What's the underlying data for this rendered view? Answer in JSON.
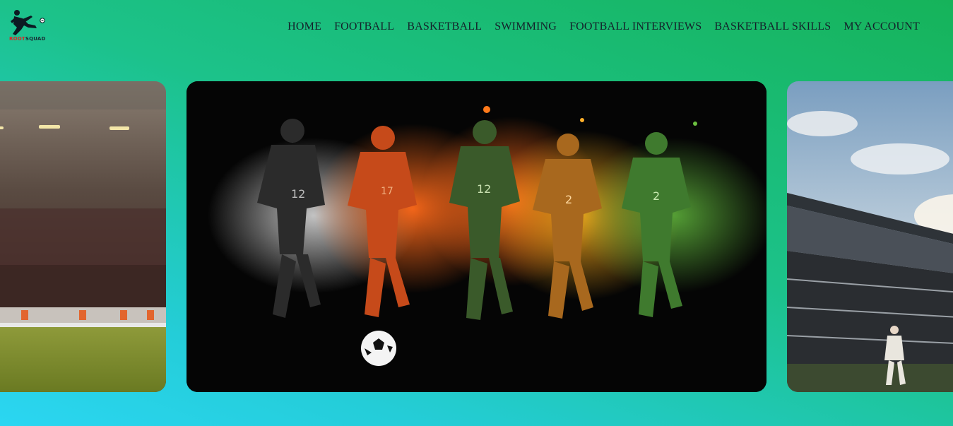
{
  "brand": {
    "logo_text_part1": "ROOT",
    "logo_text_part2": "SQUAD"
  },
  "nav": {
    "items": [
      {
        "label": "HOME"
      },
      {
        "label": "FOOTBALL"
      },
      {
        "label": "BASKETBALL"
      },
      {
        "label": "SWIMMING"
      },
      {
        "label": "FOOTBALL INTERVIEWS"
      },
      {
        "label": "BASKETBALL SKILLS"
      },
      {
        "label": "MY ACCOUNT"
      }
    ]
  },
  "carousel": {
    "slides": [
      {
        "name": "stadium-crowd-photo"
      },
      {
        "name": "football-players-running-art"
      },
      {
        "name": "stadium-stands-photo"
      }
    ],
    "active_index": 1
  }
}
